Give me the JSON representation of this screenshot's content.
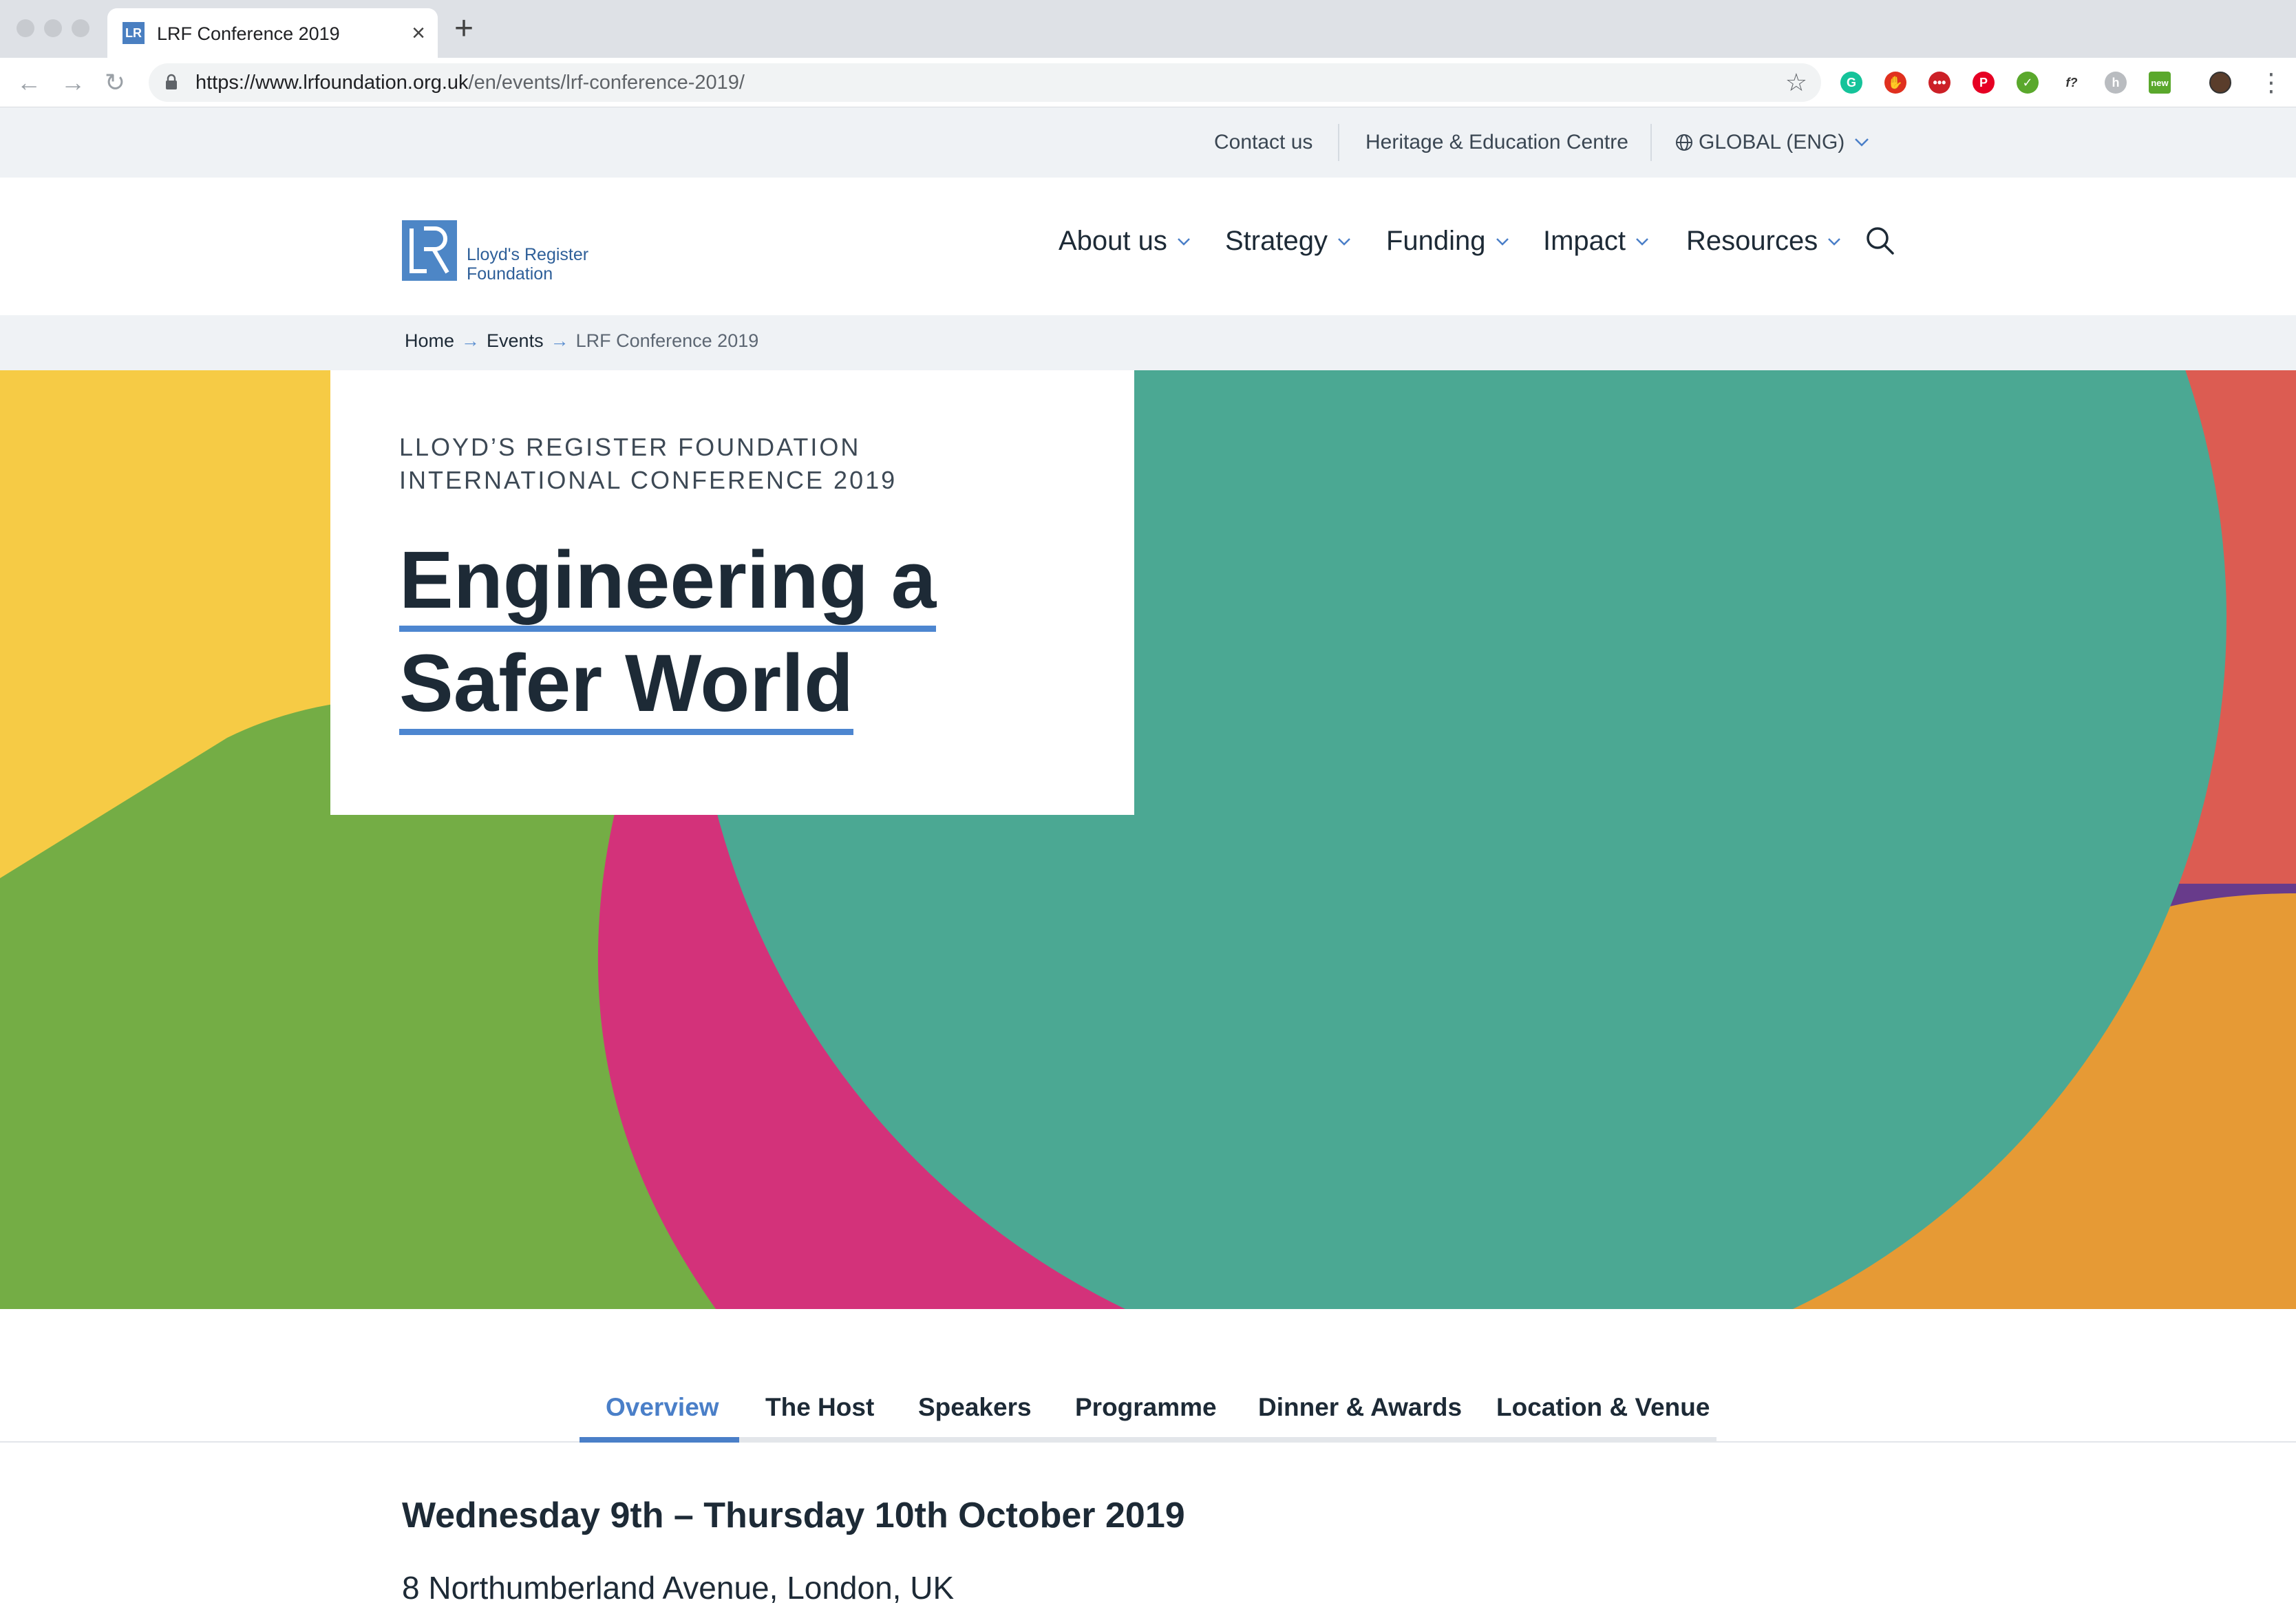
{
  "browser": {
    "tab_title": "LRF Conference 2019",
    "tab_favicon": "LR",
    "url_host": "https://www.lrfoundation.org.uk",
    "url_path": "/en/events/lrf-conference-2019/",
    "extensions": [
      {
        "name": "grammarly-icon",
        "color": "#15c39a",
        "glyph": "G"
      },
      {
        "name": "ublock-icon",
        "color": "#e0301e",
        "glyph": "✋"
      },
      {
        "name": "lastpass-icon",
        "color": "#cc2027",
        "glyph": "•••"
      },
      {
        "name": "pinterest-icon",
        "color": "#e60023",
        "glyph": "P"
      },
      {
        "name": "check-icon",
        "color": "#5aa82c",
        "glyph": "✓"
      },
      {
        "name": "whatfont-icon",
        "color": "#ffffff",
        "glyph": "f?"
      },
      {
        "name": "extension-gray-icon",
        "color": "#b9bcc0",
        "glyph": "h"
      },
      {
        "name": "new-extension-icon",
        "color": "#ffffff",
        "glyph": "new"
      }
    ]
  },
  "utility": {
    "contact": "Contact us",
    "heritage": "Heritage & Education Centre",
    "region": "GLOBAL (ENG)"
  },
  "header": {
    "logo_line1": "Lloyd's Register",
    "logo_line2": "Foundation",
    "nav": [
      "About us",
      "Strategy",
      "Funding",
      "Impact",
      "Resources"
    ]
  },
  "breadcrumb": {
    "home": "Home",
    "events": "Events",
    "current": "LRF Conference 2019"
  },
  "hero": {
    "kicker": "Lloyd’s Register Foundation International Conference 2019",
    "title_line1": "Engineering a",
    "title_line2": "Safer World",
    "colors": {
      "yellow": "#f6cb45",
      "green": "#74ad45",
      "magenta": "#d3327a",
      "teal": "#4ba893",
      "purple": "#683b8b",
      "red": "#dc5c52",
      "orange": "#e69a35"
    }
  },
  "tabs": {
    "items": [
      "Overview",
      "The Host",
      "Speakers",
      "Programme",
      "Dinner & Awards",
      "Location & Venue"
    ],
    "active": "Overview",
    "accent": "#4a7fc8"
  },
  "event": {
    "date": "Wednesday 9th – Thursday 10th October 2019",
    "place": "8 Northumberland Avenue, London, UK"
  }
}
